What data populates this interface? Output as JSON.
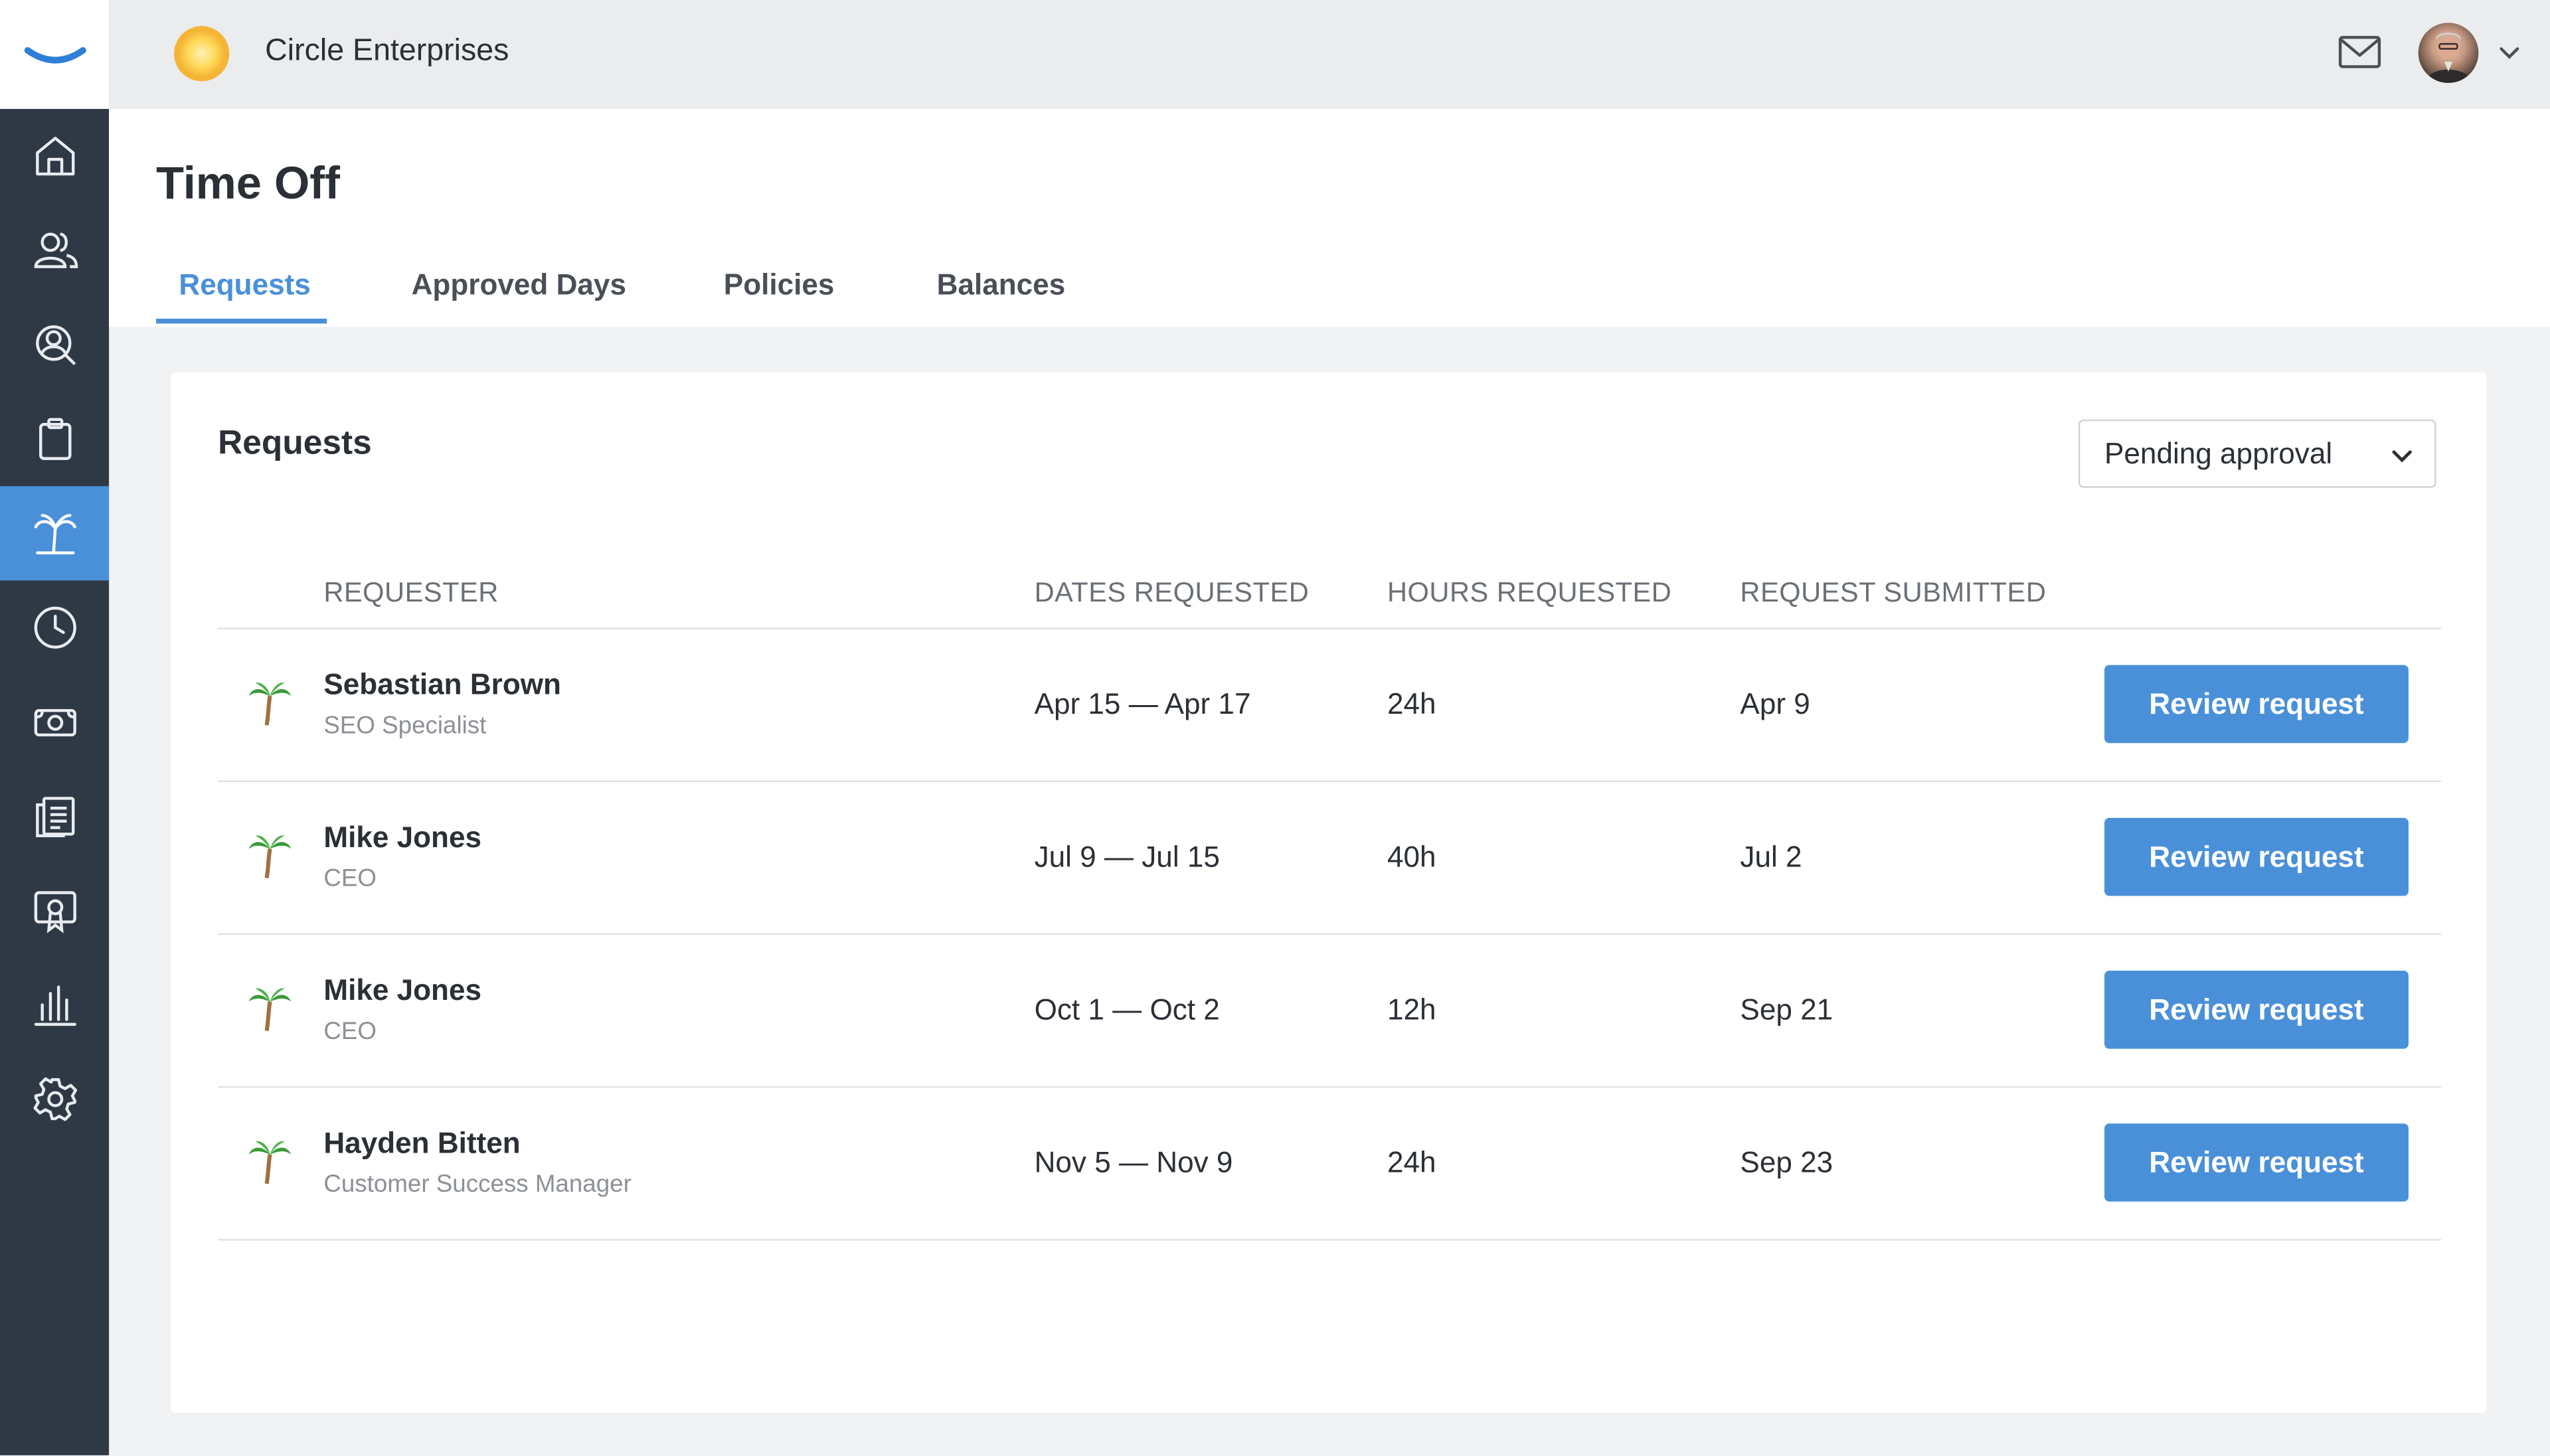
{
  "app": {
    "company_name": "Circle Enterprises",
    "logo_icon": "smile-arc-logo",
    "company_logo_icon": "sun-circle-logo"
  },
  "sidebar": {
    "items": [
      {
        "icon": "home-icon",
        "active": false
      },
      {
        "icon": "people-icon",
        "active": false
      },
      {
        "icon": "user-search-icon",
        "active": false
      },
      {
        "icon": "clipboard-icon",
        "active": false
      },
      {
        "icon": "palm-tree-icon",
        "active": true
      },
      {
        "icon": "clock-icon",
        "active": false
      },
      {
        "icon": "money-icon",
        "active": false
      },
      {
        "icon": "documents-icon",
        "active": false
      },
      {
        "icon": "certificate-icon",
        "active": false
      },
      {
        "icon": "bar-chart-icon",
        "active": false
      },
      {
        "icon": "gear-icon",
        "active": false
      }
    ],
    "accent_color": "#4a90d9",
    "background_color": "#2f3946"
  },
  "header": {
    "title": "Time Off",
    "tabs": [
      {
        "label": "Requests",
        "active": true
      },
      {
        "label": "Approved Days",
        "active": false
      },
      {
        "label": "Policies",
        "active": false
      },
      {
        "label": "Balances",
        "active": false
      }
    ]
  },
  "requests": {
    "title": "Requests",
    "filter": {
      "selected": "Pending approval"
    },
    "columns": {
      "requester": "REQUESTER",
      "dates": "DATES REQUESTED",
      "hours": "HOURS REQUESTED",
      "submitted": "REQUEST SUBMITTED"
    },
    "rows": [
      {
        "name": "Sebastian Brown",
        "role": "SEO Specialist",
        "dates": "Apr 15 — Apr 17",
        "hours": "24h",
        "submitted": "Apr 9",
        "action": "Review request"
      },
      {
        "name": "Mike Jones",
        "role": "CEO",
        "dates": "Jul 9 — Jul 15",
        "hours": "40h",
        "submitted": "Jul 2",
        "action": "Review request"
      },
      {
        "name": "Mike Jones",
        "role": "CEO",
        "dates": "Oct 1 — Oct 2",
        "hours": "12h",
        "submitted": "Sep 21",
        "action": "Review request"
      },
      {
        "name": "Hayden Bitten",
        "role": "Customer Success Manager",
        "dates": "Nov 5 — Nov 9",
        "hours": "24h",
        "submitted": "Sep 23",
        "action": "Review request"
      }
    ]
  }
}
